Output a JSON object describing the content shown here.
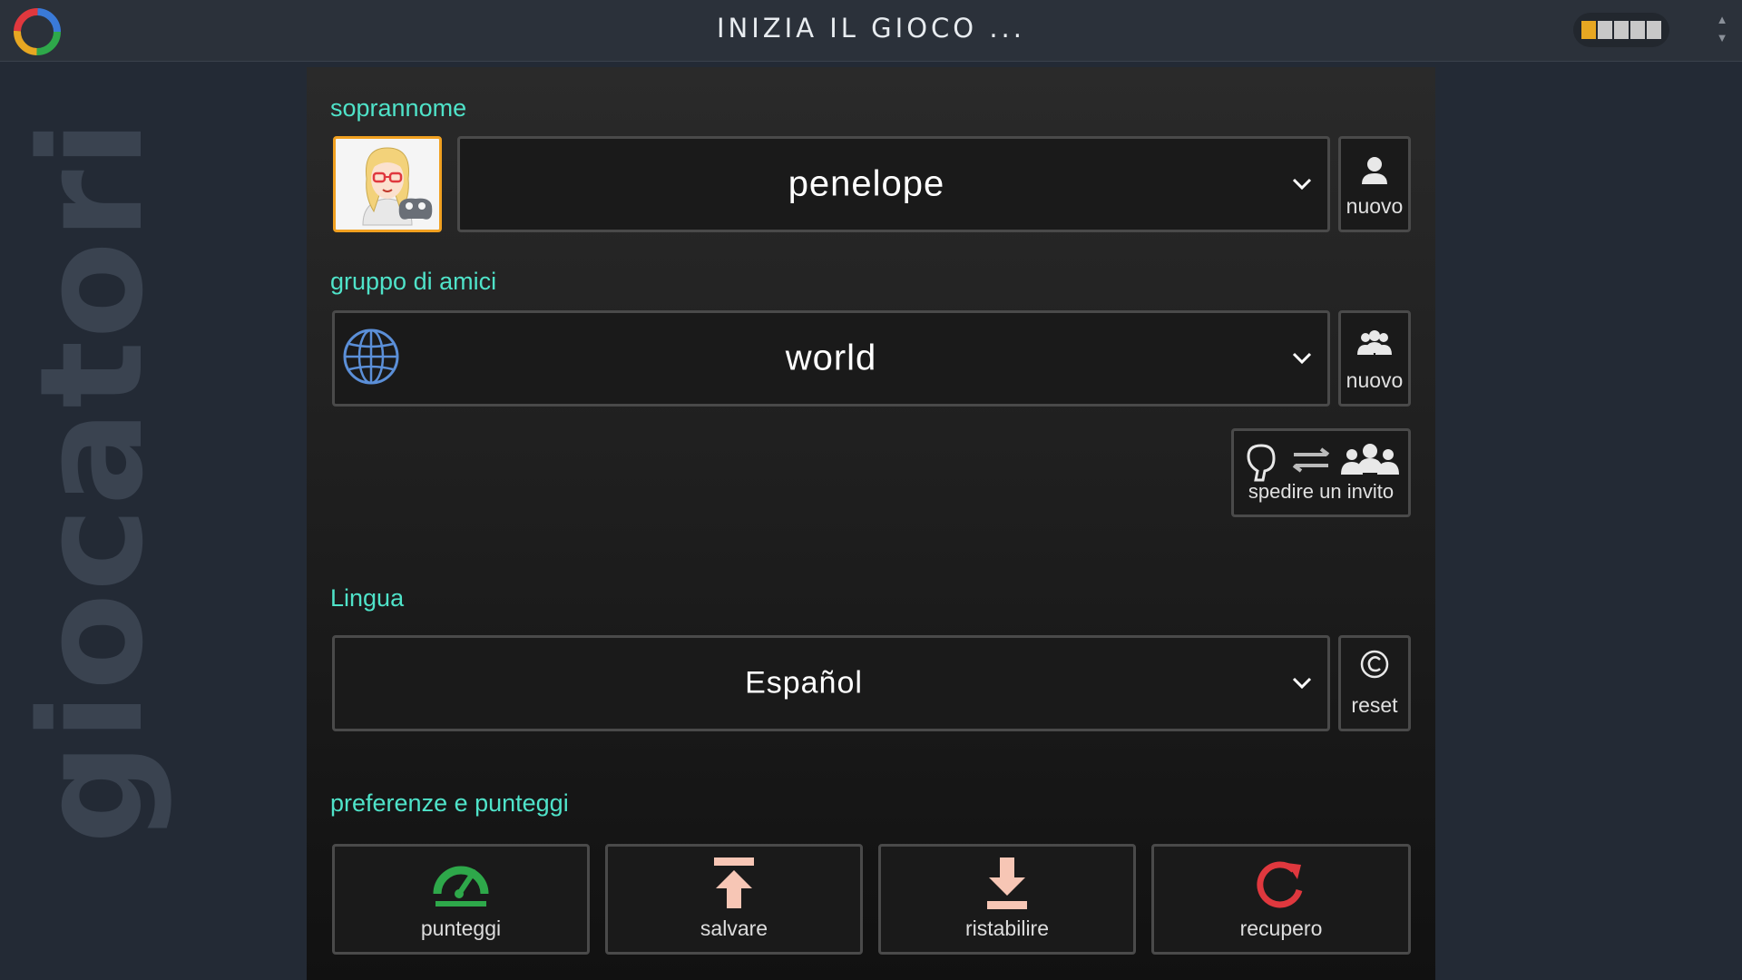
{
  "header": {
    "title": "INIZIA IL GIOCO ...",
    "level_segments": [
      true,
      false,
      false,
      false,
      false
    ]
  },
  "sidebar": {
    "vertical_title": "giocatori"
  },
  "nickname": {
    "label": "soprannome",
    "avatar_icon": "avatar-blonde-girl-mask",
    "value": "penelope",
    "new_button": "nuovo"
  },
  "friends_group": {
    "label": "gruppo di amici",
    "icon": "globe-icon",
    "value": "world",
    "new_button": "nuovo",
    "invite_button": "spedire un invito"
  },
  "language": {
    "label": "Lingua",
    "value": "Español",
    "reset_button": "reset"
  },
  "preferences": {
    "label": "preferenze e punteggi",
    "buttons": [
      {
        "label": "punteggi",
        "icon": "speedometer-icon",
        "color": "#2ea84a"
      },
      {
        "label": "salvare",
        "icon": "upload-icon",
        "color": "#f7c6b5"
      },
      {
        "label": "ristabilire",
        "icon": "download-icon",
        "color": "#f7c6b5"
      },
      {
        "label": "recupero",
        "icon": "refresh-icon",
        "color": "#e0383e"
      }
    ]
  },
  "colors": {
    "accent_label": "#4fe3c9",
    "avatar_border": "#f0a020",
    "background": "#232a35"
  }
}
